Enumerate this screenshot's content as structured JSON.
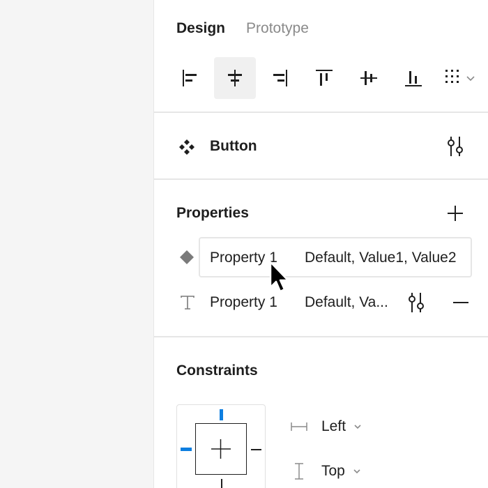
{
  "tabs": {
    "design": "Design",
    "prototype": "Prototype"
  },
  "align_bar": {
    "buttons": [
      {
        "name": "align-left-icon",
        "selected": false
      },
      {
        "name": "align-horizontal-center-icon",
        "selected": true
      },
      {
        "name": "align-right-icon",
        "selected": false
      },
      {
        "name": "align-top-icon",
        "selected": false
      },
      {
        "name": "align-vertical-center-icon",
        "selected": false
      },
      {
        "name": "align-bottom-icon",
        "selected": false
      },
      {
        "name": "distribute-grid-icon",
        "selected": false
      }
    ]
  },
  "component": {
    "name": "Button",
    "icon": "component-icon",
    "settings_icon": "adjust-sliders-icon"
  },
  "properties": {
    "title": "Properties",
    "add_icon": "plus-icon",
    "items": [
      {
        "type_icon": "variant-diamond-icon",
        "name": "Property 1",
        "value": "Default, Value1, Value2",
        "editing": true
      },
      {
        "type_icon": "text-type-icon",
        "name": "Property 1",
        "value": "Default, Va...",
        "settings_icon": "adjust-sliders-icon",
        "remove_icon": "minus-icon"
      }
    ]
  },
  "constraints": {
    "title": "Constraints",
    "accent": "#0d7ee0",
    "horizontal": {
      "icon": "horizontal-constraint-icon",
      "value": "Left"
    },
    "vertical": {
      "icon": "vertical-constraint-icon",
      "value": "Top"
    }
  }
}
